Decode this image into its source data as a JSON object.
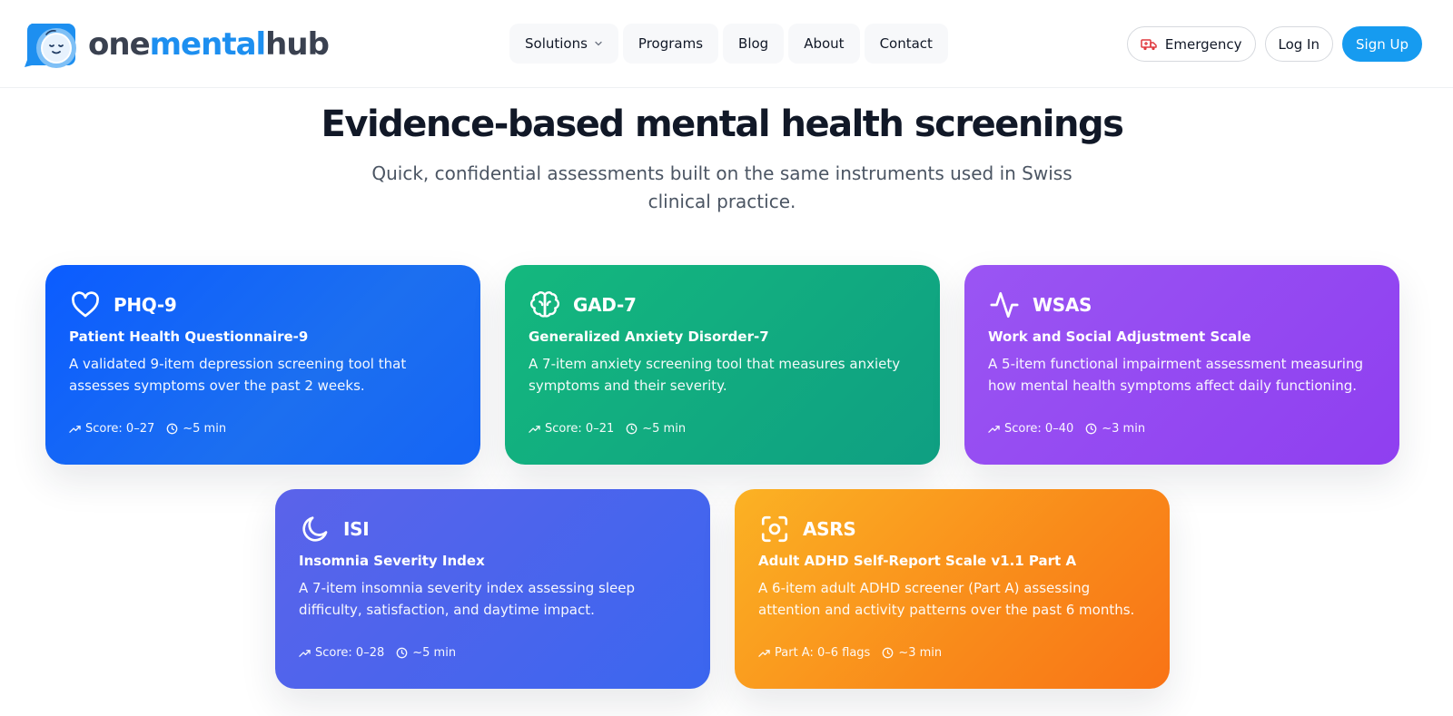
{
  "brand": {
    "one": "one",
    "mental": "mental",
    "hub": "hub"
  },
  "nav": {
    "solutions": "Solutions",
    "programs": "Programs",
    "blog": "Blog",
    "about": "About",
    "contact": "Contact"
  },
  "actions": {
    "emergency": "Emergency",
    "login": "Log In",
    "signup": "Sign Up"
  },
  "hero": {
    "title": "Evidence-based mental health screenings",
    "subtitle": "Quick, confidential assessments built on the same instruments used in Swiss clinical practice."
  },
  "cards": [
    {
      "icon": "heart-icon",
      "title": "PHQ-9",
      "subtitle": "Patient Health Questionnaire-9",
      "description": "A validated 9-item depression screening tool that assesses symptoms over the past 2 weeks.",
      "score": "Score: 0–27",
      "time": "~5 min",
      "color": "#0b5cff"
    },
    {
      "icon": "brain-icon",
      "title": "GAD-7",
      "subtitle": "Generalized Anxiety Disorder-7",
      "description": "A 7-item anxiety screening tool that measures anxiety symptoms and their severity.",
      "score": "Score: 0–21",
      "time": "~5 min",
      "color": "#10b981"
    },
    {
      "icon": "activity-icon",
      "title": "WSAS",
      "subtitle": "Work and Social Adjustment Scale",
      "description": "A 5-item functional impairment assessment measuring how mental health symptoms affect daily functioning.",
      "score": "Score: 0–40",
      "time": "~3 min",
      "color": "#9333ea"
    },
    {
      "icon": "moon-icon",
      "title": "ISI",
      "subtitle": "Insomnia Severity Index",
      "description": "A 7-item insomnia severity index assessing sleep difficulty, satisfaction, and daytime impact.",
      "score": "Score: 0–28",
      "time": "~5 min",
      "color": "#4f62eb"
    },
    {
      "icon": "focus-icon",
      "title": "ASRS",
      "subtitle": "Adult ADHD Self-Report Scale v1.1 Part A",
      "description": "A 6-item adult ADHD screener (Part A) assessing attention and activity patterns over the past 6 months.",
      "score": "Part A: 0–6 flags",
      "time": "~3 min",
      "color": "#f97316"
    }
  ]
}
